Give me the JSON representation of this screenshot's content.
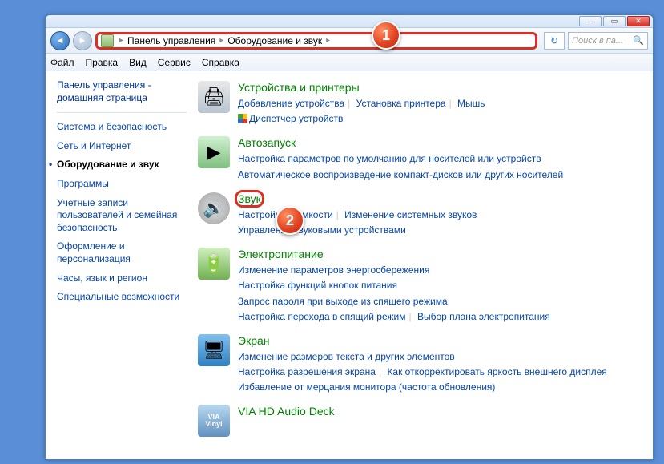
{
  "breadcrumb": {
    "root": "Панель управления",
    "sub": "Оборудование и звук"
  },
  "search": {
    "placeholder": "Поиск в па..."
  },
  "menu": {
    "file": "Файл",
    "edit": "Правка",
    "view": "Вид",
    "tools": "Сервис",
    "help": "Справка"
  },
  "sidebar": {
    "home": "Панель управления - домашняя страница",
    "items": [
      "Система и безопасность",
      "Сеть и Интернет",
      "Оборудование и звук",
      "Программы",
      "Учетные записи пользователей и семейная безопасность",
      "Оформление и персонализация",
      "Часы, язык и регион",
      "Специальные возможности"
    ]
  },
  "categories": {
    "devices": {
      "title": "Устройства и принтеры",
      "links": [
        "Добавление устройства",
        "Установка принтера",
        "Мышь"
      ],
      "shield": "Диспетчер устройств"
    },
    "autoplay": {
      "title": "Автозапуск",
      "links": [
        "Настройка параметров по умолчанию для носителей или устройств",
        "Автоматическое воспроизведение компакт-дисков или других носителей"
      ]
    },
    "sound": {
      "title": "Звук",
      "links": [
        "Настройка громкости",
        "Изменение системных звуков",
        "Управление звуковыми устройствами"
      ]
    },
    "power": {
      "title": "Электропитание",
      "links": [
        "Изменение параметров энергосбережения",
        "Настройка функций кнопок питания",
        "Запрос пароля при выходе из спящего режима",
        "Настройка перехода в спящий режим",
        "Выбор плана электропитания"
      ]
    },
    "display": {
      "title": "Экран",
      "links": [
        "Изменение размеров текста и других элементов",
        "Настройка разрешения экрана",
        "Как откорректировать яркость внешнего дисплея",
        "Избавление от мерцания монитора (частота обновления)"
      ]
    },
    "via": {
      "title": "VIA HD Audio Deck"
    }
  },
  "markers": {
    "m1": "1",
    "m2": "2"
  }
}
